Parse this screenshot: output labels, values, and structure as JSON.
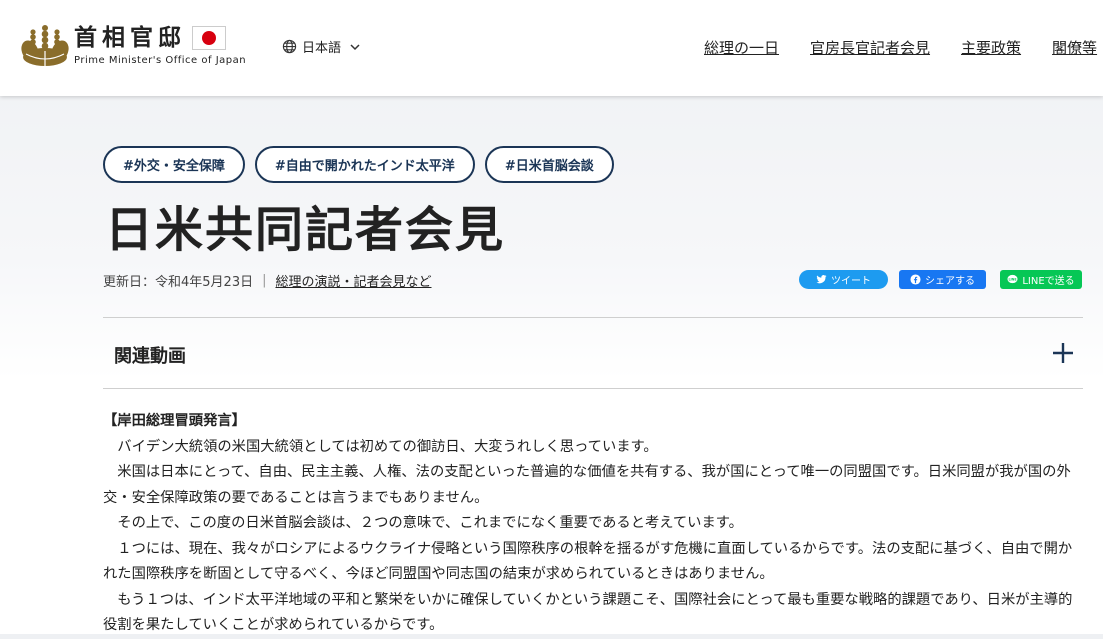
{
  "header": {
    "logo_jp": "首相官邸",
    "logo_en": "Prime Minister's Office of Japan",
    "language": "日本語",
    "nav": [
      "総理の一日",
      "官房長官記者会見",
      "主要政策",
      "閣僚等"
    ]
  },
  "tags": [
    "#外交・安全保障",
    "#自由で開かれたインド太平洋",
    "#日米首脳会談"
  ],
  "title": "日米共同記者会見",
  "meta": {
    "updated": "更新日：令和4年5月23日",
    "separator": "|",
    "category_link": "総理の演説・記者会見など"
  },
  "share": {
    "twitter": "ツイート",
    "facebook": "シェアする",
    "line": "LINEで送る"
  },
  "accordion": {
    "label": "関連動画"
  },
  "content": {
    "heading": "【岸田総理冒頭発言】",
    "paragraphs": [
      "　バイデン大統領の米国大統領としては初めての御訪日、大変うれしく思っています。",
      "　米国は日本にとって、自由、民主主義、人権、法の支配といった普遍的な価値を共有する、我が国にとって唯一の同盟国です。日米同盟が我が国の外交・安全保障政策の要であることは言うまでもありません。",
      "　その上で、この度の日米首脳会談は、２つの意味で、これまでになく重要であると考えています。",
      "　１つには、現在、我々がロシアによるウクライナ侵略という国際秩序の根幹を揺るがす危機に直面しているからです。法の支配に基づく、自由で開かれた国際秩序を断固として守るべく、今ほど同盟国や同志国の結束が求められているときはありません。",
      "　もう１つは、インド太平洋地域の平和と繁栄をいかに確保していくかという課題こそ、国際社会にとって最も重要な戦略的課題であり、日米が主導的役割を果たしていくことが求められているからです。"
    ]
  },
  "colors": {
    "tag_border": "#1b3556",
    "twitter": "#1d9bf0",
    "facebook": "#1877f2",
    "line": "#06c755",
    "flag_red": "#d7000f"
  },
  "icons": [
    "paulownia-emblem-icon",
    "globe-icon",
    "chevron-down-icon",
    "twitter-bird-icon",
    "facebook-icon",
    "line-icon",
    "plus-icon"
  ]
}
